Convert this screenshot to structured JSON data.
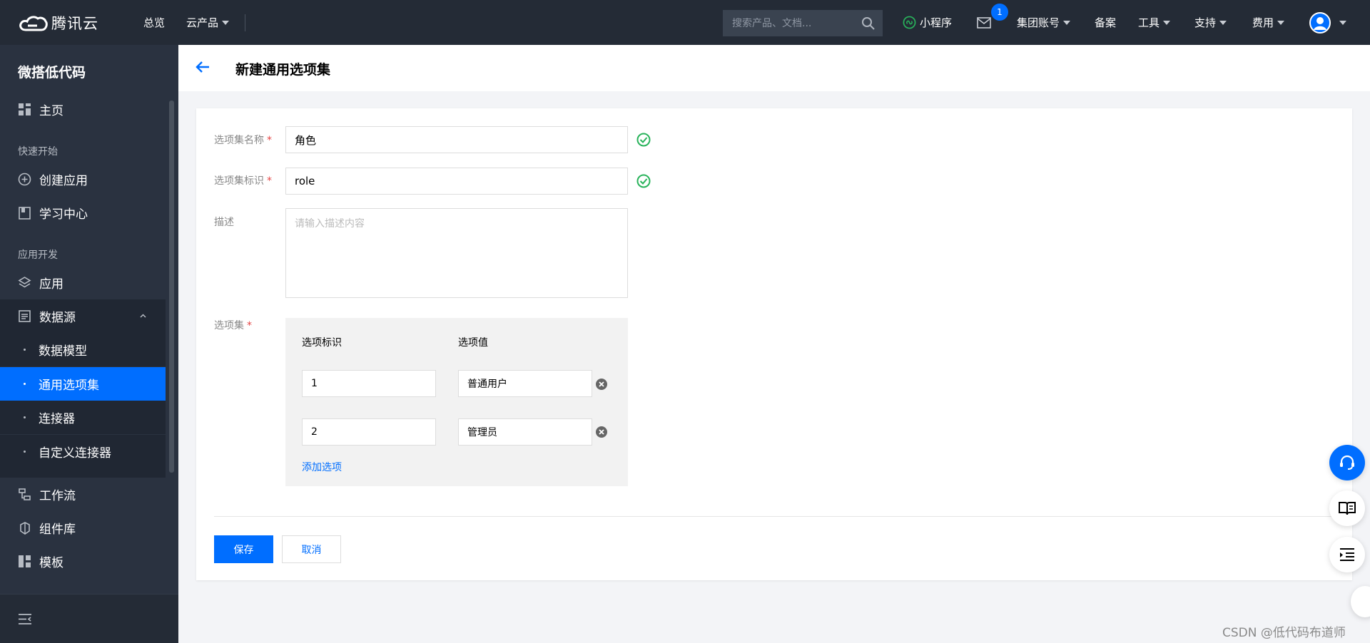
{
  "topbar": {
    "brand": "腾讯云",
    "nav": [
      {
        "label": "总览"
      },
      {
        "label": "云产品"
      }
    ],
    "search_placeholder": "搜索产品、文档...",
    "miniprogram_label": "小程序",
    "message_count": "1",
    "account_label": "集团账号",
    "filing_label": "备案",
    "tools_label": "工具",
    "support_label": "支持",
    "billing_label": "费用"
  },
  "sidebar": {
    "title": "微搭低代码",
    "home_label": "主页",
    "section_quickstart": "快速开始",
    "create_app_label": "创建应用",
    "learning_label": "学习中心",
    "section_appdev": "应用开发",
    "app_label": "应用",
    "datasource_label": "数据源",
    "sub_items": [
      {
        "label": "数据模型"
      },
      {
        "label": "通用选项集"
      },
      {
        "label": "连接器"
      },
      {
        "label": "自定义连接器"
      }
    ],
    "workflow_label": "工作流",
    "components_label": "组件库",
    "templates_label": "模板"
  },
  "page": {
    "title": "新建通用选项集"
  },
  "form": {
    "name_label": "选项集名称",
    "name_value": "角色",
    "id_label": "选项集标识",
    "id_value": "role",
    "desc_label": "描述",
    "desc_placeholder": "请输入描述内容",
    "options_label": "选项集",
    "required_mark": "*",
    "col_key": "选项标识",
    "col_value": "选项值",
    "options": [
      {
        "key": "1",
        "value": "普通用户"
      },
      {
        "key": "2",
        "value": "管理员"
      }
    ],
    "add_option_label": "添加选项",
    "save_label": "保存",
    "cancel_label": "取消"
  },
  "watermark": "CSDN @低代码布道师",
  "colors": {
    "primary": "#006eff",
    "topbar_bg": "#242b36",
    "sidebar_bg": "#2a3240",
    "success": "#29b35b",
    "required": "#e54545"
  }
}
